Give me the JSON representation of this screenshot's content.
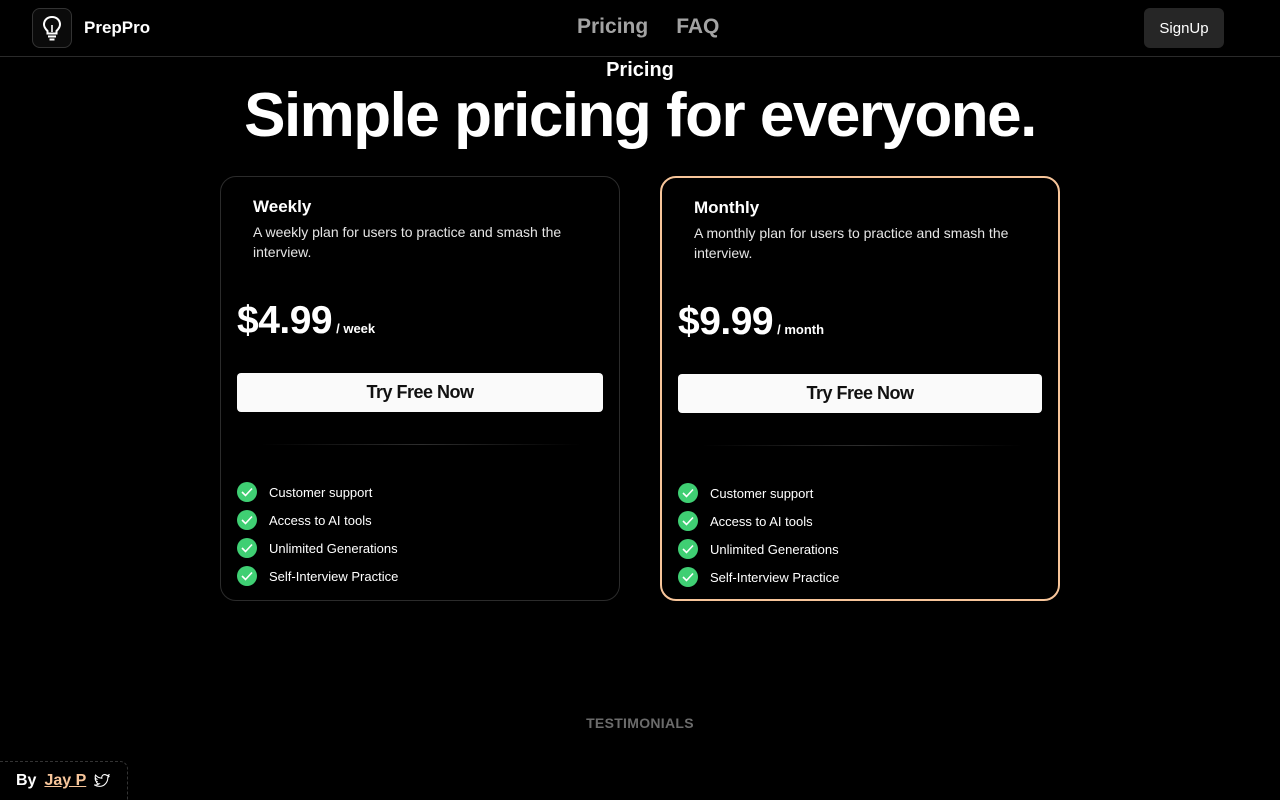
{
  "header": {
    "brand": "PrepPro",
    "nav": [
      {
        "label": "Pricing"
      },
      {
        "label": "FAQ"
      }
    ],
    "signup_label": "SignUp"
  },
  "hero": {
    "eyebrow": "Pricing",
    "title": "Simple pricing for everyone."
  },
  "plans": [
    {
      "name": "Weekly",
      "description": "A weekly plan for users to practice and smash the interview.",
      "price": "$4.99",
      "period": "/ week",
      "cta_label": "Try Free Now",
      "highlighted": false,
      "features": [
        "Customer support",
        "Access to AI tools",
        "Unlimited Generations",
        "Self-Interview Practice"
      ]
    },
    {
      "name": "Monthly",
      "description": "A monthly plan for users to practice and smash the interview.",
      "price": "$9.99",
      "period": "/ month",
      "cta_label": "Try Free Now",
      "highlighted": true,
      "features": [
        "Customer support",
        "Access to AI tools",
        "Unlimited Generations",
        "Self-Interview Practice"
      ]
    }
  ],
  "testimonials_heading": "TESTIMONIALS",
  "footer": {
    "by_label": "By",
    "author": "Jay P",
    "social_icon": "twitter-icon"
  },
  "colors": {
    "accent": "#f7c59a",
    "check": "#3fcf73",
    "background": "#000000"
  }
}
